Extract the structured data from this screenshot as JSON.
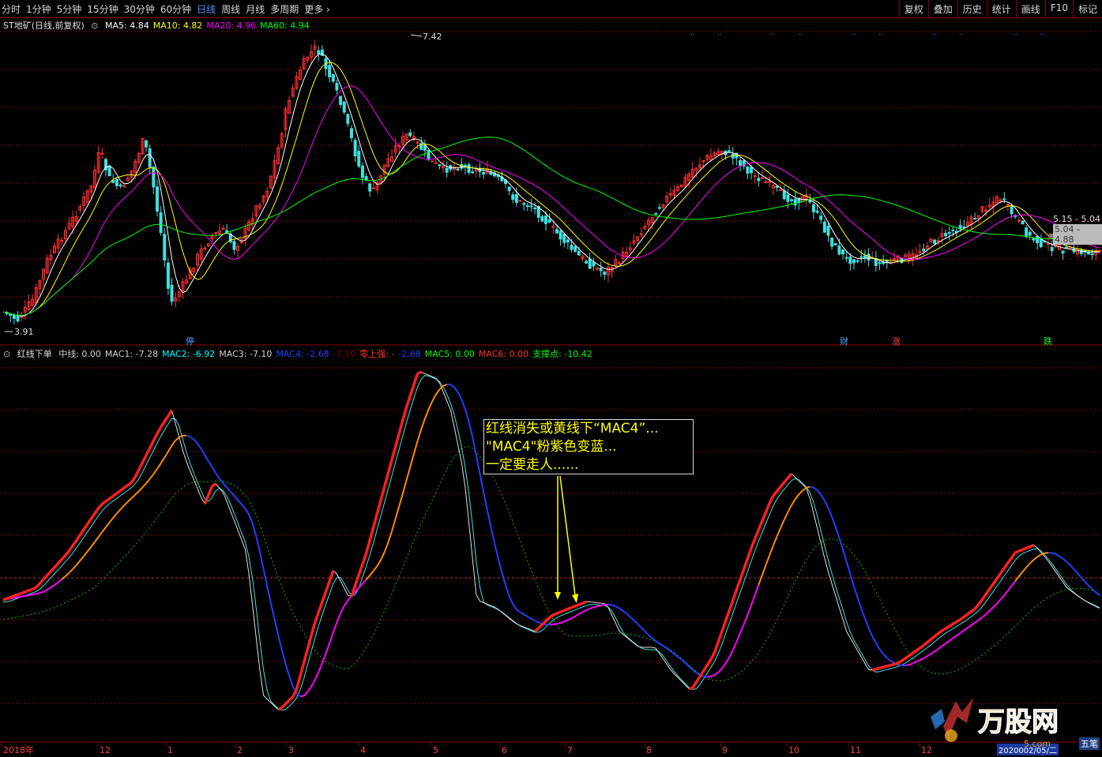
{
  "toolbar": {
    "periods": [
      "分时",
      "1分钟",
      "5分钟",
      "15分钟",
      "30分钟",
      "60分钟",
      "日线",
      "周线",
      "月线",
      "多周期",
      "更多"
    ],
    "active_period": "日线",
    "tools": [
      "复权",
      "叠加",
      "历史",
      "统计",
      "画线",
      "F10",
      "标记"
    ]
  },
  "main_chart": {
    "title": "ST地矿(日线,前复权)",
    "ma_labels": [
      {
        "text": "MA5: 4.84",
        "color": "#ffffff"
      },
      {
        "text": "MA10: 4.82",
        "color": "#ffff00"
      },
      {
        "text": "MA20: 4.96",
        "color": "#ff00ff"
      },
      {
        "text": "MA60: 4.94",
        "color": "#00ff00"
      }
    ],
    "high_label": "7.42",
    "low_label": "3.91",
    "price_tag_1": "5.15 - 5.04",
    "price_tag_2": "5.04 - 4.88",
    "event_markers": [
      {
        "text": "停",
        "color": "#4aa0ff"
      },
      {
        "text": "财",
        "color": "#4aa0ff"
      },
      {
        "text": "涨",
        "color": "#ff4040"
      },
      {
        "text": "跌",
        "color": "#00ff00"
      }
    ]
  },
  "indicator": {
    "name": "红线下单",
    "values": [
      {
        "text": "中线: 0.00",
        "color": "#d0d0d0"
      },
      {
        "text": "MAC1: -7.28",
        "color": "#d0d0d0"
      },
      {
        "text": "MAC2: -6.92",
        "color": "#00ffff"
      },
      {
        "text": "MAC3: -7.10",
        "color": "#d0d0d0"
      },
      {
        "text": "MAC4: -2.68",
        "color": "#2040ff"
      },
      {
        "text": "-7.10",
        "color": "#800000"
      },
      {
        "text": "零上强: -",
        "color": "#ff3030"
      },
      {
        "text": "-2.68",
        "color": "#2040ff"
      },
      {
        "text": "MAC5: 0.00",
        "color": "#00ff00"
      },
      {
        "text": "MAC6: 0.00",
        "color": "#ff3030"
      },
      {
        "text": "支撑点: -10.42",
        "color": "#00ff00"
      }
    ]
  },
  "annotation": {
    "lines": [
      "红线消失或黄线下“MAC4”...",
      "\"MAC4\"粉紫色变蓝...",
      "一定要走人......"
    ]
  },
  "time_axis": [
    "2018年",
    "12",
    "1",
    "2",
    "3",
    "4",
    "5",
    "6",
    "7",
    "8",
    "9",
    "10",
    "11",
    "12"
  ],
  "footer": {
    "date_tag": "2020002/05/二",
    "button": "五笔"
  },
  "watermark": {
    "brand": "万股网",
    "url": "5.com"
  },
  "colors": {
    "up": "#ff3030",
    "down": "#40e0e0",
    "grid": "#8b0000"
  }
}
